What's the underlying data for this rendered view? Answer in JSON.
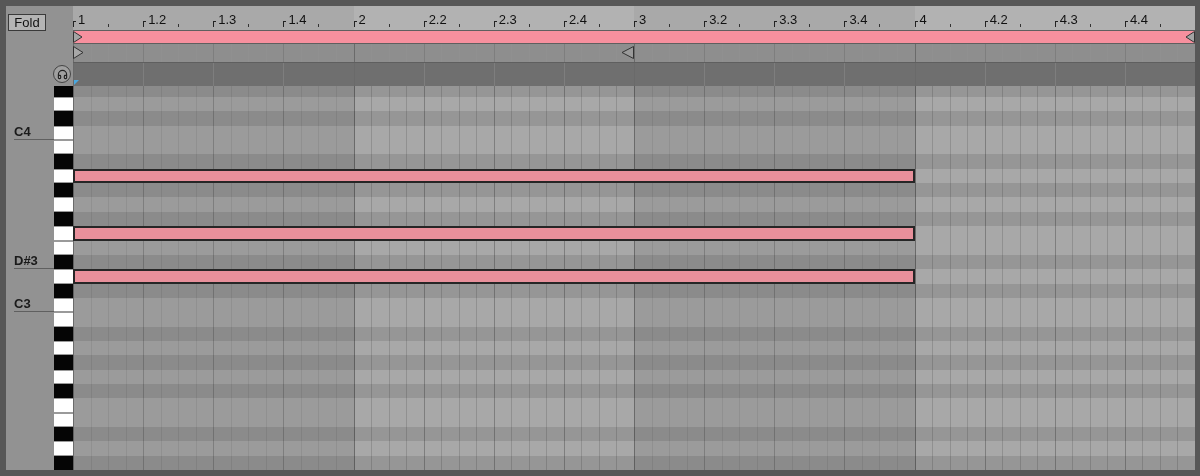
{
  "fold_button": "Fold",
  "ruler": [
    "1",
    "1.2",
    "1.3",
    "1.4",
    "2",
    "2.2",
    "2.3",
    "2.4",
    "3",
    "3.2",
    "3.3",
    "3.4",
    "4",
    "4.2",
    "4.3",
    "4.4"
  ],
  "loop": {
    "on": true
  },
  "end_marker": {
    "level": 0.5
  },
  "keys": [
    {
      "kind": "black"
    },
    {
      "kind": "white"
    },
    {
      "kind": "black"
    },
    {
      "kind": "white",
      "label": "C4"
    },
    {
      "kind": "white"
    },
    {
      "kind": "black"
    },
    {
      "kind": "white",
      "note": {
        "level": 0.75
      }
    },
    {
      "kind": "black"
    },
    {
      "kind": "white"
    },
    {
      "kind": "black"
    },
    {
      "kind": "white",
      "note": {
        "level": 0.75
      }
    },
    {
      "kind": "white"
    },
    {
      "kind": "black",
      "label": "D#3"
    },
    {
      "kind": "white",
      "note": {
        "level": 0.75
      }
    },
    {
      "kind": "black"
    },
    {
      "kind": "white",
      "label": "C3"
    },
    {
      "kind": "white"
    },
    {
      "kind": "black"
    },
    {
      "kind": "white"
    },
    {
      "kind": "black"
    },
    {
      "kind": "white"
    },
    {
      "kind": "black"
    },
    {
      "kind": "white"
    },
    {
      "kind": "white"
    },
    {
      "kind": "black"
    },
    {
      "kind": "white"
    },
    {
      "kind": "black"
    }
  ]
}
